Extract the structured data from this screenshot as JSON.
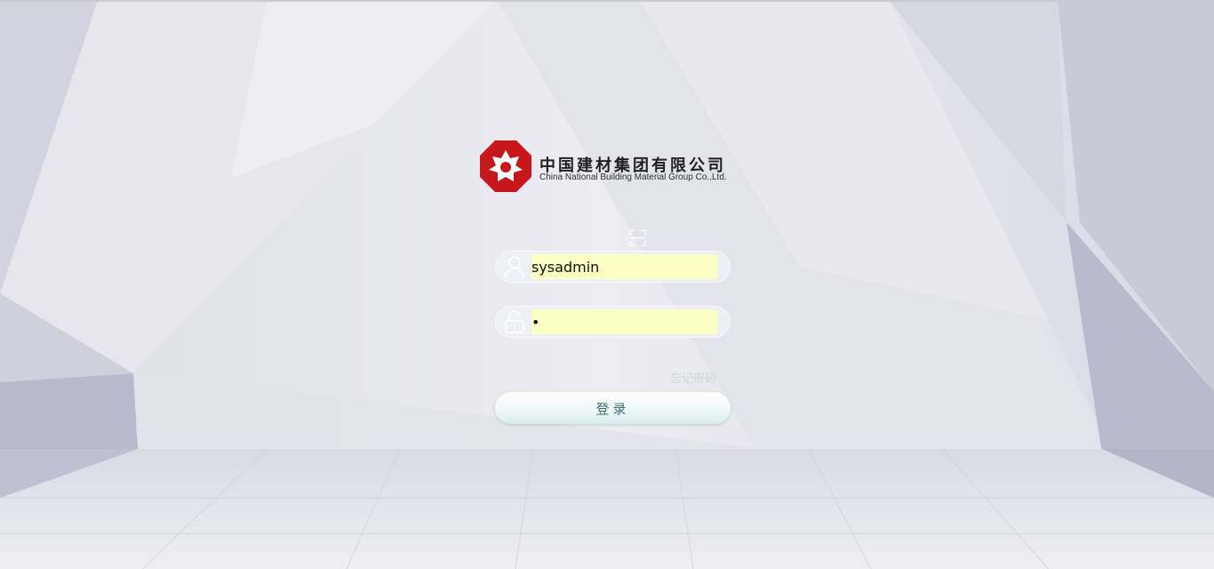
{
  "brand": {
    "name_cn": "中国建材集团有限公司",
    "name_en": "China National Building Material Group Co.,Ltd.",
    "logo_color": "#c8161d"
  },
  "login": {
    "qr_toggle_icon": "qr-scan-icon",
    "username": {
      "icon": "user-icon",
      "value": "sysadmin"
    },
    "password": {
      "icon": "unlock-icon",
      "value": "•"
    },
    "forgot_password_label": "忘记密码",
    "submit_label": "登录"
  },
  "colors": {
    "autofill_bg": "#fbffc4",
    "button_text": "#3e6d78",
    "forgot_text": "#c6d8dc"
  }
}
